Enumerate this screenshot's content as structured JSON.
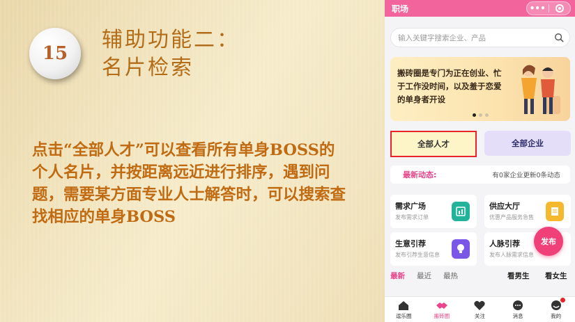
{
  "slide": {
    "number": "15",
    "title_line1": "辅助功能二：",
    "title_line2": "名片检索",
    "body": "点击“全部人才”可以查看所有单身BOSS的个人名片，并按距离远近进行排序，遇到问题，需要某方面专业人士解答时，可以搜索查找相应的单身BOSS"
  },
  "phone": {
    "title": "职场",
    "capsule_dots": "•••",
    "search": {
      "placeholder": "输入关键字搜索企业、产品",
      "icon": "search-icon"
    },
    "banner": {
      "text": "搬砖圈是专门为正在创业、忙于工作没时间，以及羞于恋爱的单身者开设",
      "active_dot": 1,
      "dot_count": 3
    },
    "buttons": {
      "talent": "全部人才",
      "company": "全部企业"
    },
    "news": {
      "label": "最新动态:",
      "value": "有0家企业更新0条动态"
    },
    "cards": [
      {
        "title": "需求广场",
        "sub": "发布需求订单",
        "icon": "chart-icon",
        "color": "#22b39a"
      },
      {
        "title": "供应大厅",
        "sub": "优惠产品服务急售",
        "icon": "document-icon",
        "color": "#f5b82e"
      },
      {
        "title": "生意引荐",
        "sub": "发布引荐生意信息",
        "icon": "bulb-icon",
        "color": "#7b57e8"
      },
      {
        "title": "人脉引荐",
        "sub": "发布人脉需求信息",
        "icon": "people-icon",
        "color": "#e8458a"
      }
    ],
    "fab": "发布",
    "tabs": {
      "latest": "最新",
      "nearby": "最近",
      "hot": "最热",
      "see_male": "看男生",
      "see_female": "看女生"
    },
    "nav": [
      {
        "label": "逗乐圈",
        "icon": "home-icon"
      },
      {
        "label": "搬砖圈",
        "icon": "handshake-icon"
      },
      {
        "label": "关注",
        "icon": "heart-icon"
      },
      {
        "label": "消息",
        "icon": "message-icon"
      },
      {
        "label": "我的",
        "icon": "profile-icon"
      }
    ],
    "colors": {
      "accent": "#f2649c",
      "highlight_border": "#e8242a"
    }
  }
}
